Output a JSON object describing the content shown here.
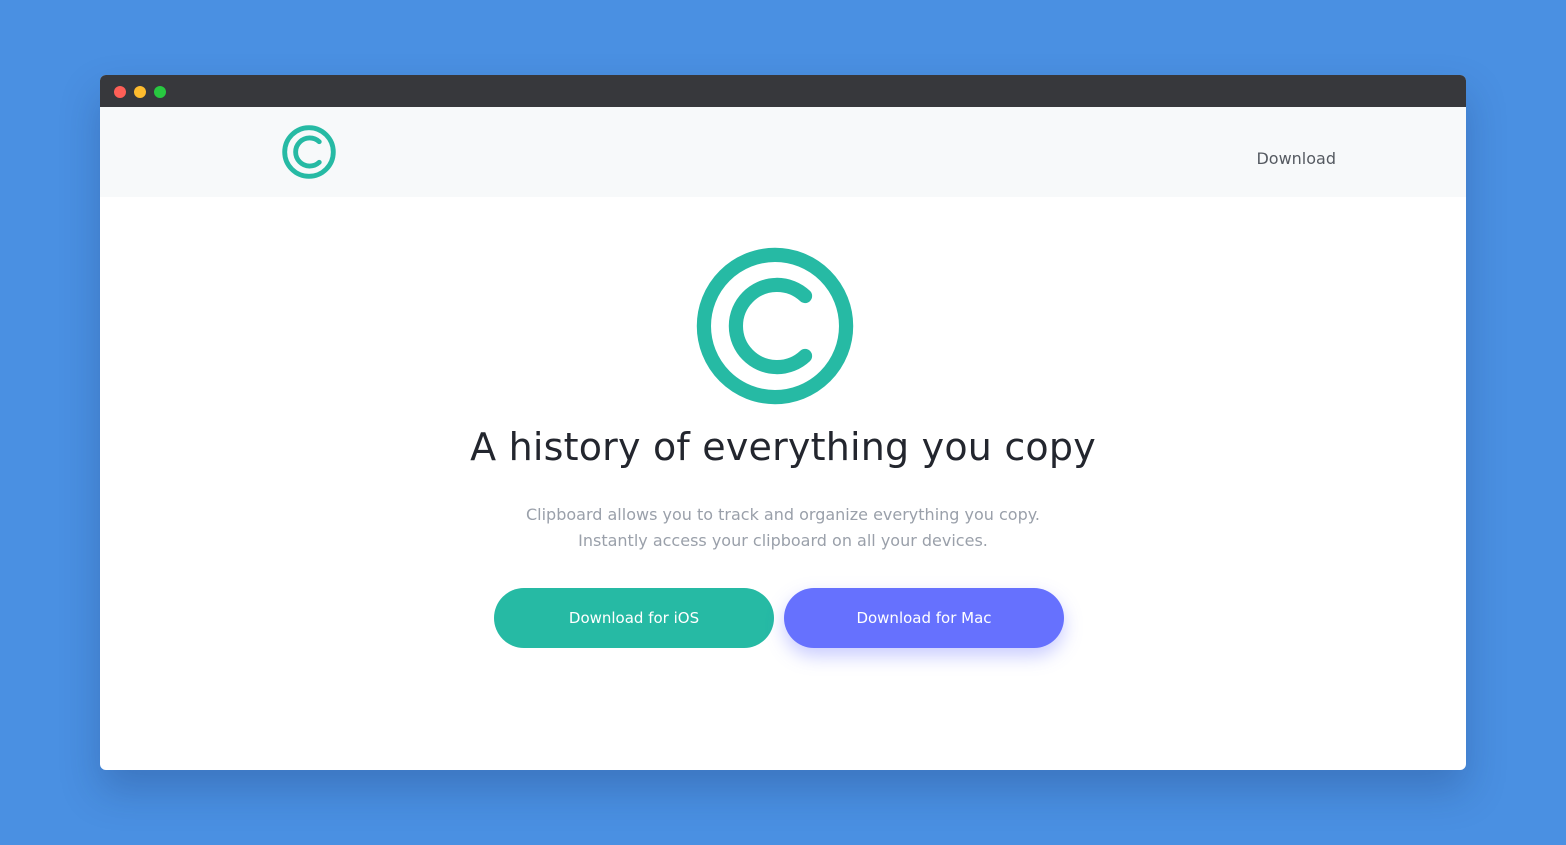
{
  "colors": {
    "background": "#4a90e2",
    "titlebar": "#37383c",
    "traffic_red": "#fe5f57",
    "traffic_yellow": "#febc2e",
    "traffic_green": "#28c840",
    "brand_teal": "#26baa4",
    "accent_indigo": "#6671fe"
  },
  "navbar": {
    "logo_icon": "copyright-icon",
    "link_label": "Download"
  },
  "hero": {
    "logo_icon": "copyright-icon",
    "headline": "A history of everything you copy",
    "subtext_line1": "Clipboard allows you to track and organize everything you copy.",
    "subtext_line2": "Instantly access your clipboard on all your devices.",
    "ios_button_label": "Download for iOS",
    "mac_button_label": "Download for Mac"
  }
}
